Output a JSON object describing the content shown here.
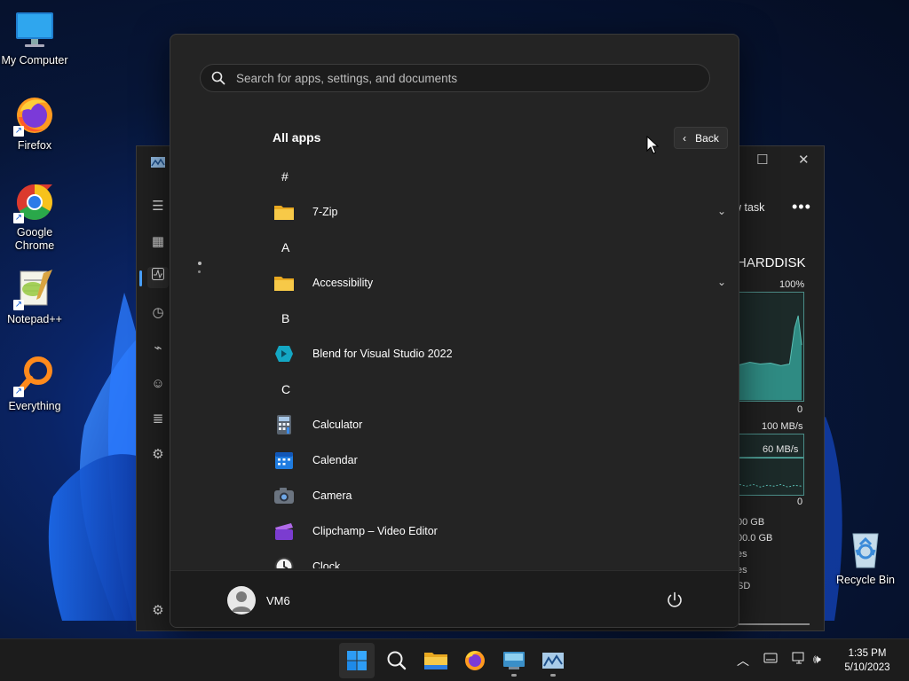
{
  "desktop": {
    "icons": [
      {
        "label": "My Computer"
      },
      {
        "label": "Firefox"
      },
      {
        "label": "Google Chrome"
      },
      {
        "label": "Notepad++"
      },
      {
        "label": "Everything"
      },
      {
        "label": "Recycle Bin"
      }
    ]
  },
  "task_manager": {
    "new_task_label": "w task",
    "more_label": "•••",
    "disk_title": "HARDDISK",
    "graph_max": "100%",
    "graph_min": "0",
    "speed_max": "100 MB/s",
    "speed_mid": "60 MB/s",
    "speed_min": "0",
    "details": [
      "00 GB",
      "00.0 GB",
      "es",
      "es",
      "SD"
    ]
  },
  "start_menu": {
    "search": {
      "placeholder": "Search for apps, settings, and documents"
    },
    "title": "All apps",
    "back_label": "Back",
    "sections": [
      {
        "letter": "#"
      },
      {
        "letter": "A"
      },
      {
        "letter": "B"
      },
      {
        "letter": "C"
      }
    ],
    "apps": [
      {
        "label": "7-Zip",
        "icon": "folder-icon"
      },
      {
        "label": "Accessibility",
        "icon": "folder-icon"
      },
      {
        "label": "Blend for Visual Studio 2022",
        "icon": "blend-icon"
      },
      {
        "label": "Calculator",
        "icon": "calculator-icon"
      },
      {
        "label": "Calendar",
        "icon": "calendar-icon"
      },
      {
        "label": "Camera",
        "icon": "camera-icon"
      },
      {
        "label": "Clipchamp – Video Editor",
        "icon": "clipchamp-icon"
      },
      {
        "label": "Clock",
        "icon": "clock-icon"
      }
    ],
    "user": {
      "name": "VM6"
    }
  },
  "taskbar": {
    "clock_time": "1:35 PM",
    "clock_date": "5/10/2023"
  },
  "colors": {
    "accent": "#4aa3ff",
    "folder": "#f5c43c",
    "start_bg": "#242424",
    "taskbar_bg": "#1c1c1c"
  }
}
